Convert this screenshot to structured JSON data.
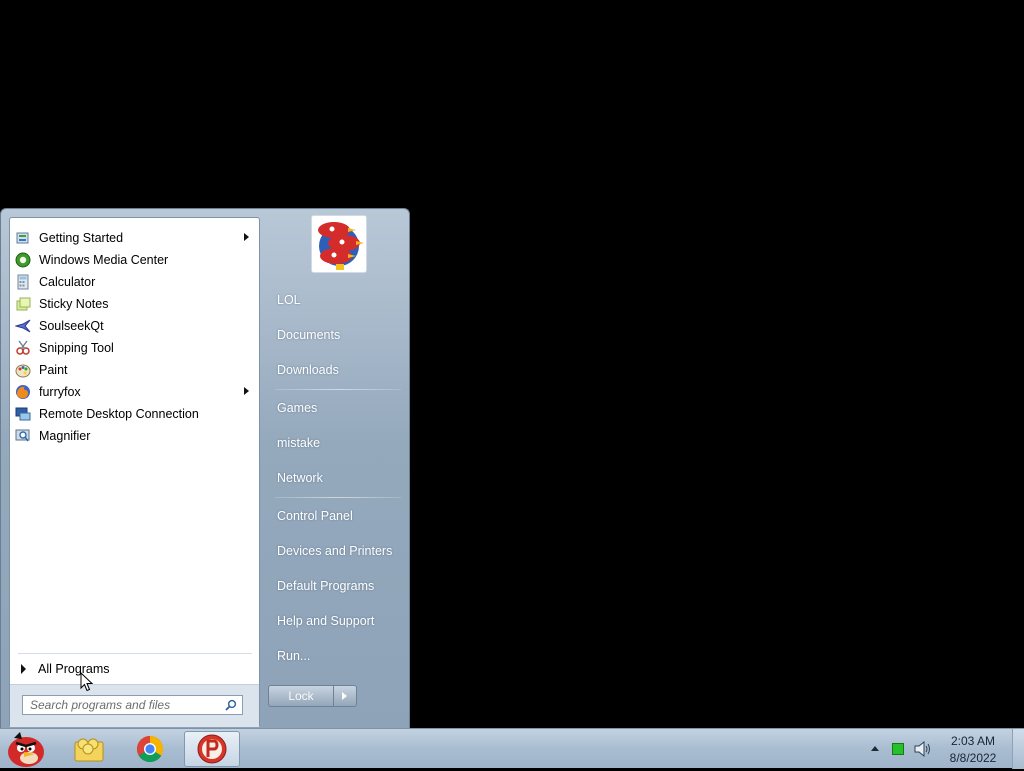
{
  "start_menu": {
    "programs": [
      {
        "label": "Getting Started",
        "icon": "getting-started-icon",
        "has_submenu": true
      },
      {
        "label": "Windows Media Center",
        "icon": "media-center-icon",
        "has_submenu": false
      },
      {
        "label": "Calculator",
        "icon": "calculator-icon",
        "has_submenu": false
      },
      {
        "label": "Sticky Notes",
        "icon": "sticky-notes-icon",
        "has_submenu": false
      },
      {
        "label": "SoulseekQt",
        "icon": "soulseek-icon",
        "has_submenu": false
      },
      {
        "label": "Snipping Tool",
        "icon": "snipping-tool-icon",
        "has_submenu": false
      },
      {
        "label": "Paint",
        "icon": "paint-icon",
        "has_submenu": false
      },
      {
        "label": "furryfox",
        "icon": "firefox-icon",
        "has_submenu": true
      },
      {
        "label": "Remote Desktop Connection",
        "icon": "remote-desktop-icon",
        "has_submenu": false
      },
      {
        "label": "Magnifier",
        "icon": "magnifier-icon",
        "has_submenu": false
      }
    ],
    "all_programs_label": "All Programs",
    "search_placeholder": "Search programs and files",
    "right_items": [
      {
        "label": "LOL"
      },
      {
        "label": "Documents"
      },
      {
        "label": "Downloads"
      },
      {
        "label": "Games"
      },
      {
        "label": "mistake"
      },
      {
        "label": "Network"
      },
      {
        "label": "Control Panel"
      },
      {
        "label": "Devices and Printers"
      },
      {
        "label": "Default Programs"
      },
      {
        "label": "Help and Support"
      },
      {
        "label": "Run..."
      }
    ],
    "shutdown_label": "Lock"
  },
  "taskbar": {
    "pinned": [
      {
        "name": "start-orb-angry-bird-icon"
      },
      {
        "name": "folder-icon"
      },
      {
        "name": "chrome-icon"
      },
      {
        "name": "app-p-icon",
        "active": true
      }
    ],
    "clock_time": "2:03 AM",
    "clock_date": "8/8/2022"
  },
  "colors": {
    "menu_blue": "#95a9bd",
    "taskbar_blue": "#a9bdd1",
    "desktop": "#000000"
  }
}
